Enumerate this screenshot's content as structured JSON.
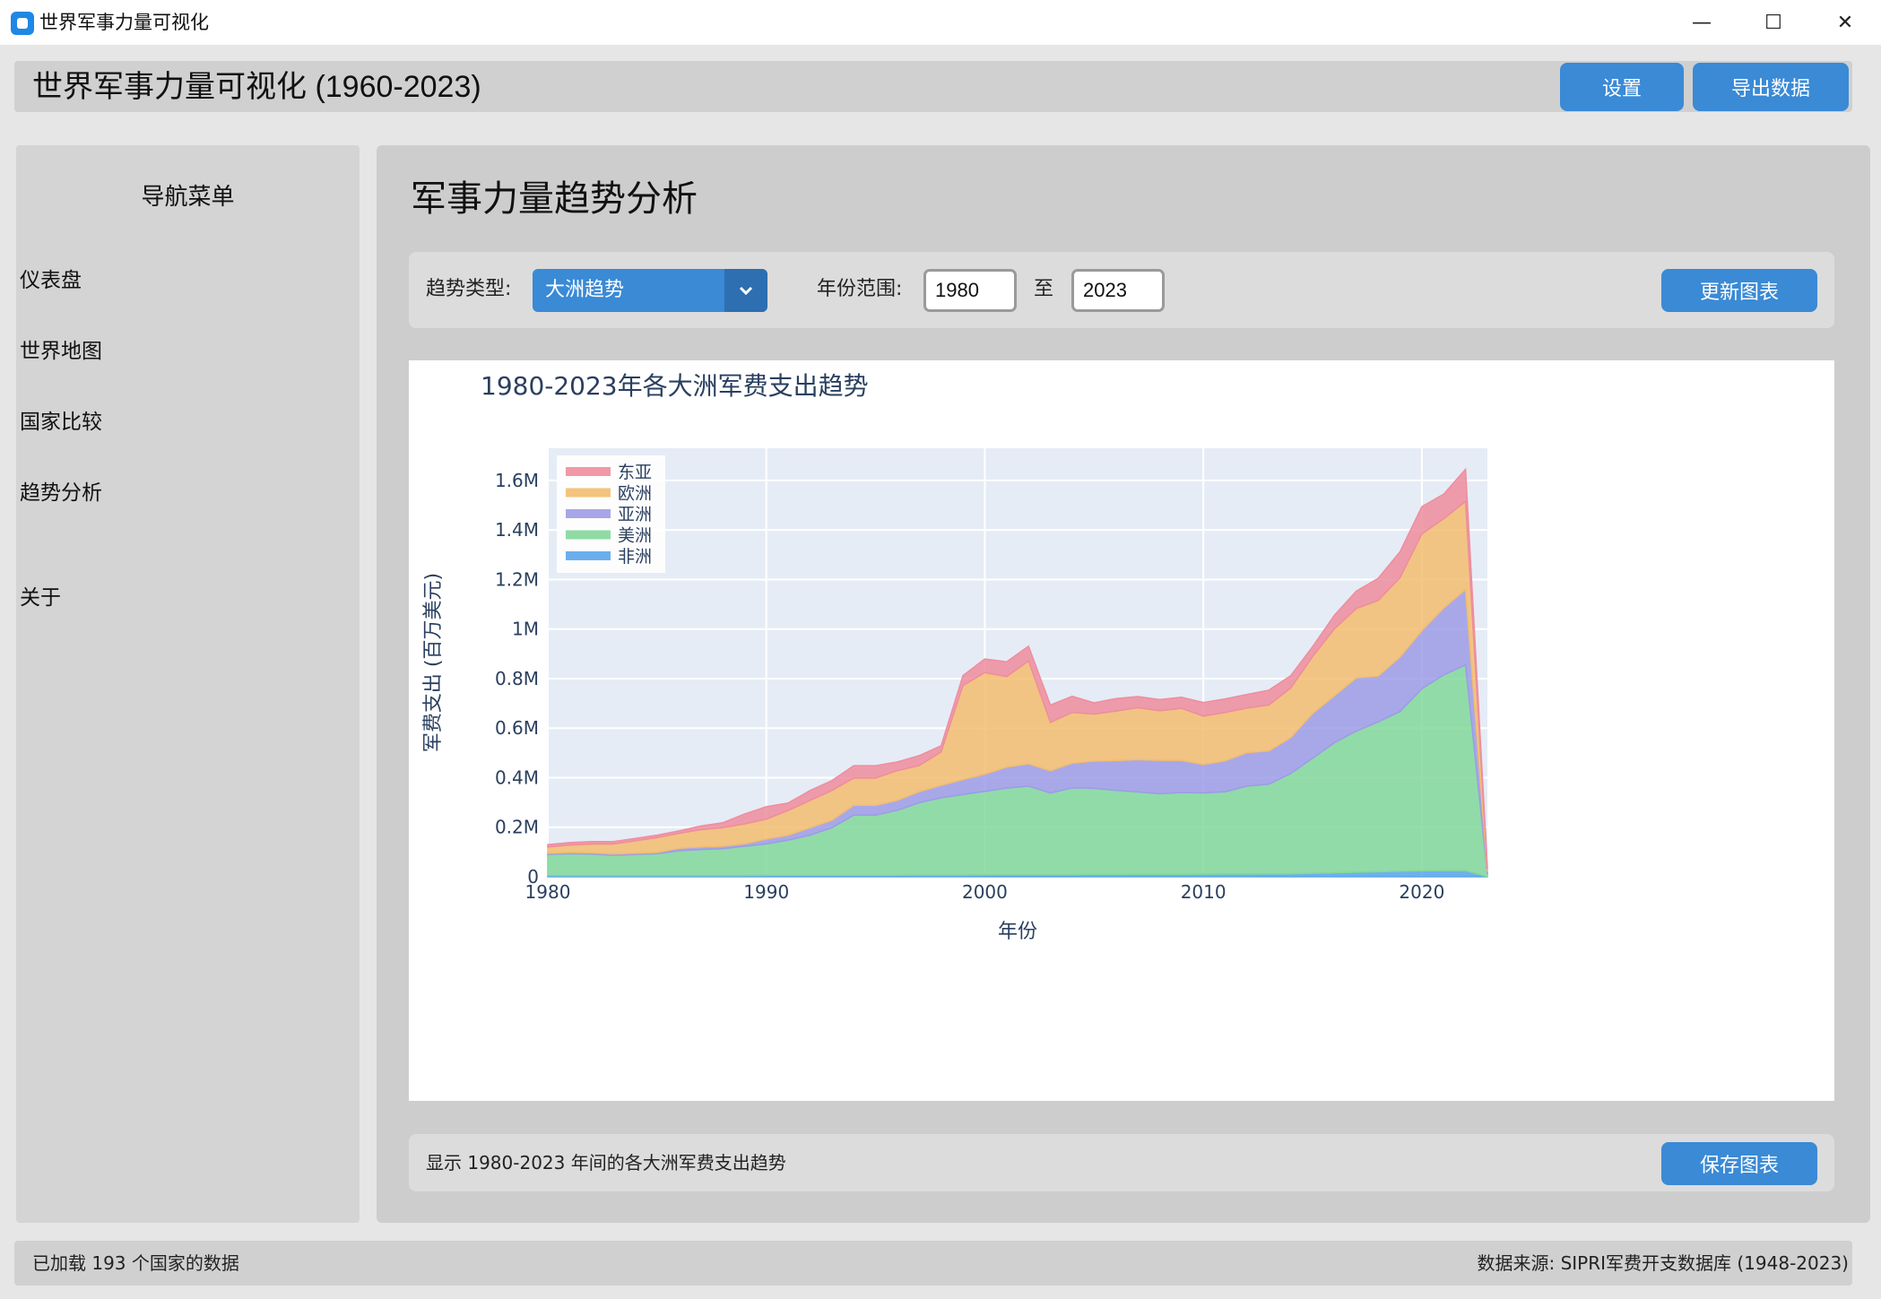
{
  "window": {
    "title": "世界军事力量可视化",
    "controls": {
      "minimize": "—",
      "maximize": "☐",
      "close": "✕"
    }
  },
  "header": {
    "title": "世界军事力量可视化 (1960-2023)",
    "settings_label": "设置",
    "export_label": "导出数据"
  },
  "sidebar": {
    "title": "导航菜单",
    "items": [
      {
        "label": "仪表盘"
      },
      {
        "label": "世界地图"
      },
      {
        "label": "国家比较"
      },
      {
        "label": "趋势分析"
      },
      {
        "label": "关于"
      }
    ]
  },
  "main": {
    "title": "军事力量趋势分析",
    "controls": {
      "trend_type_label": "趋势类型:",
      "trend_type_value": "大洲趋势",
      "year_range_label": "年份范围:",
      "year_from": "1980",
      "to_label": "至",
      "year_to": "2023",
      "update_label": "更新图表"
    },
    "info_text": "显示 1980-2023 年间的各大洲军费支出趋势",
    "save_label": "保存图表"
  },
  "status": {
    "left": "已加载 193 个国家的数据",
    "right": "数据来源: SIPRI军费开支数据库 (1948-2023)"
  },
  "colors": {
    "accent": "#3a8ad6",
    "plot_bg": "#e5ecf6",
    "africa": "#5aa5ec",
    "americas": "#82d89a",
    "asia": "#9d9ce6",
    "europe": "#f3bd6e",
    "east_asia": "#ef8d9d"
  },
  "chart_data": {
    "type": "area",
    "title": "1980-2023年各大洲军费支出趋势",
    "xlabel": "年份",
    "ylabel": "军费支出 (百万美元)",
    "xlim": [
      1980,
      2023
    ],
    "ylim": [
      0,
      1730000
    ],
    "x_ticks": [
      1980,
      1990,
      2000,
      2010,
      2020
    ],
    "y_ticks": [
      0,
      200000,
      400000,
      600000,
      800000,
      1000000,
      1200000,
      1400000,
      1600000
    ],
    "y_tick_labels": [
      "0",
      "0.2M",
      "0.4M",
      "0.6M",
      "0.8M",
      "1M",
      "1.2M",
      "1.4M",
      "1.6M"
    ],
    "grid": true,
    "legend_position": "top-left",
    "stacked": true,
    "x": [
      1980,
      1981,
      1982,
      1983,
      1984,
      1985,
      1986,
      1987,
      1988,
      1989,
      1990,
      1991,
      1992,
      1993,
      1994,
      1995,
      1996,
      1997,
      1998,
      1999,
      2000,
      2001,
      2002,
      2003,
      2004,
      2005,
      2006,
      2007,
      2008,
      2009,
      2010,
      2011,
      2012,
      2013,
      2014,
      2015,
      2016,
      2017,
      2018,
      2019,
      2020,
      2021,
      2022,
      2023
    ],
    "series": [
      {
        "name": "非洲",
        "color": "#5aa5ec",
        "values": [
          5000,
          5000,
          5000,
          5000,
          5000,
          5000,
          5000,
          5000,
          5000,
          5000,
          5500,
          6000,
          6000,
          6000,
          6500,
          6500,
          6500,
          7000,
          7000,
          7000,
          7500,
          8000,
          8000,
          8000,
          8500,
          9000,
          9000,
          9500,
          10000,
          10000,
          10500,
          11000,
          11000,
          11500,
          12000,
          14000,
          16000,
          18000,
          20000,
          22000,
          24000,
          25000,
          25000,
          500
        ]
      },
      {
        "name": "美洲",
        "color": "#82d89a",
        "values": [
          85000,
          88000,
          87000,
          82000,
          85000,
          88000,
          100000,
          105000,
          108000,
          118000,
          127000,
          142000,
          162000,
          192000,
          242000,
          242000,
          262000,
          292000,
          312000,
          325000,
          337000,
          350000,
          358000,
          330000,
          350000,
          348000,
          340000,
          333000,
          325000,
          330000,
          328000,
          332000,
          355000,
          362000,
          405000,
          465000,
          525000,
          570000,
          605000,
          645000,
          735000,
          790000,
          830000,
          10000
        ]
      },
      {
        "name": "亚洲",
        "color": "#9d9ce6",
        "values": [
          5000,
          5000,
          5000,
          5000,
          5000,
          5000,
          10000,
          10000,
          10000,
          10000,
          20000,
          20000,
          30000,
          30000,
          40000,
          40000,
          40000,
          45000,
          50000,
          60000,
          70000,
          85000,
          90000,
          90000,
          100000,
          110000,
          120000,
          130000,
          135000,
          130000,
          115000,
          125000,
          135000,
          135000,
          145000,
          180000,
          190000,
          215000,
          185000,
          220000,
          235000,
          270000,
          305000,
          10000
        ]
      },
      {
        "name": "欧洲",
        "color": "#f3bd6e",
        "values": [
          25000,
          30000,
          35000,
          40000,
          50000,
          60000,
          60000,
          70000,
          75000,
          80000,
          80000,
          100000,
          110000,
          120000,
          110000,
          110000,
          120000,
          105000,
          135000,
          380000,
          410000,
          365000,
          415000,
          195000,
          205000,
          190000,
          200000,
          210000,
          200000,
          210000,
          195000,
          195000,
          180000,
          185000,
          200000,
          230000,
          270000,
          280000,
          305000,
          320000,
          390000,
          360000,
          355000,
          10000
        ]
      },
      {
        "name": "东亚",
        "color": "#ef8d9d",
        "values": [
          10000,
          10000,
          10000,
          10000,
          10000,
          10000,
          10000,
          15000,
          20000,
          40000,
          50000,
          30000,
          40000,
          40000,
          50000,
          50000,
          35000,
          40000,
          25000,
          40000,
          55000,
          60000,
          60000,
          70000,
          65000,
          45000,
          50000,
          45000,
          45000,
          45000,
          55000,
          55000,
          55000,
          60000,
          50000,
          40000,
          55000,
          70000,
          90000,
          105000,
          110000,
          100000,
          130000,
          5000
        ]
      }
    ]
  }
}
